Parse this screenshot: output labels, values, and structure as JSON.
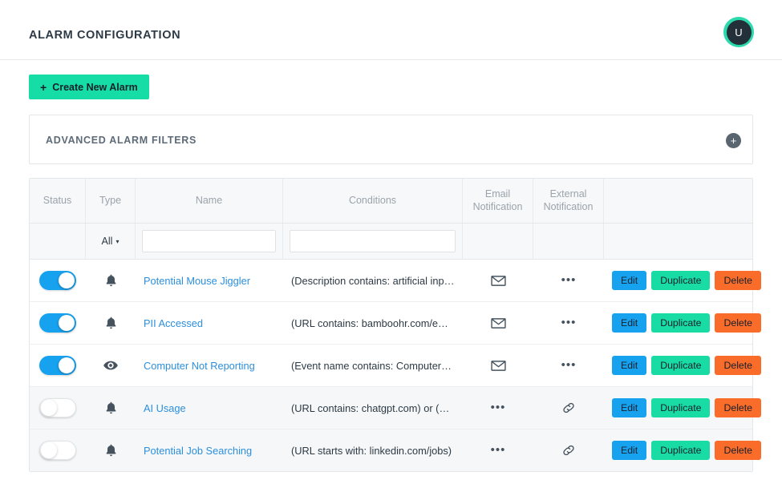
{
  "header": {
    "title": "ALARM CONFIGURATION",
    "avatar_initial": "U"
  },
  "toolbar": {
    "create_label": "Create New Alarm",
    "create_plus": "+"
  },
  "filters": {
    "title": "ADVANCED ALARM FILTERS",
    "add_glyph": "+"
  },
  "table": {
    "columns": [
      "Status",
      "Type",
      "Name",
      "Conditions",
      "Email Notification",
      "External Notification",
      ""
    ],
    "filter_row": {
      "type_value": "All",
      "type_caret": "▾",
      "name_value": "",
      "name_placeholder": "",
      "conditions_value": "",
      "conditions_placeholder": ""
    },
    "dots_glyph": "•••",
    "actions": {
      "edit": "Edit",
      "duplicate": "Duplicate",
      "delete": "Delete"
    },
    "rows": [
      {
        "enabled": true,
        "type_icon": "bell-icon",
        "name": "Potential Mouse Jiggler",
        "conditions": "(Description contains: artificial input)",
        "email_icon": "envelope-icon",
        "external_icon": "ellipsis-icon"
      },
      {
        "enabled": true,
        "type_icon": "bell-icon",
        "name": "PII Accessed",
        "conditions": "(URL contains: bamboohr.com/emplo…",
        "email_icon": "envelope-icon",
        "external_icon": "ellipsis-icon"
      },
      {
        "enabled": true,
        "type_icon": "eye-icon",
        "name": "Computer Not Reporting",
        "conditions": "(Event name contains: ComputersNot…",
        "email_icon": "envelope-icon",
        "external_icon": "ellipsis-icon"
      },
      {
        "enabled": false,
        "type_icon": "bell-icon",
        "name": "AI Usage",
        "conditions": "(URL contains: chatgpt.com) or (URL…",
        "email_icon": "ellipsis-icon",
        "external_icon": "link-icon"
      },
      {
        "enabled": false,
        "type_icon": "bell-icon",
        "name": "Potential Job Searching",
        "conditions": "(URL starts with: linkedin.com/jobs)",
        "email_icon": "ellipsis-icon",
        "external_icon": "link-icon"
      }
    ]
  },
  "colors": {
    "accent_teal": "#16dda6",
    "toggle_on": "#17a2f0",
    "edit": "#17a2f0",
    "duplicate": "#19dba4",
    "delete": "#f96c29",
    "link": "#2b8fdd"
  }
}
